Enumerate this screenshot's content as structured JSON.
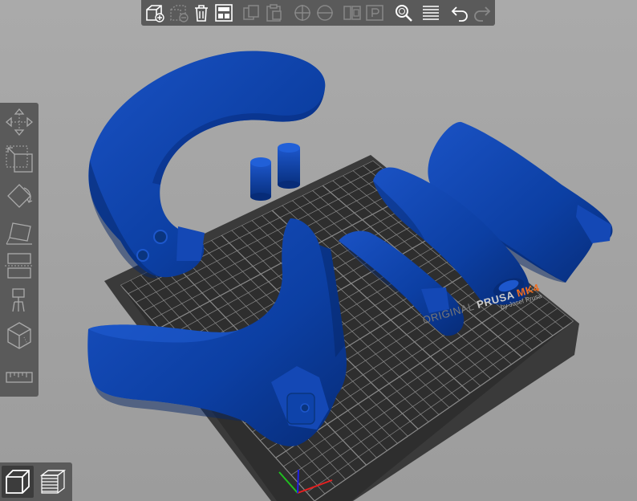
{
  "app": "PrusaSlicer 3D view",
  "toolbar": {
    "buttons": [
      {
        "name": "add-button",
        "icon": "cube-add-icon",
        "enabled": true
      },
      {
        "name": "delete-button",
        "icon": "cube-delete-icon",
        "enabled": false
      },
      {
        "name": "delete-all-button",
        "icon": "trash-icon",
        "enabled": true
      },
      {
        "name": "arrange-button",
        "icon": "arrange-icon",
        "enabled": true
      },
      {
        "name": "copy-button",
        "icon": "copy-icon",
        "enabled": false
      },
      {
        "name": "paste-button",
        "icon": "paste-icon",
        "enabled": false
      },
      {
        "name": "add-instance-button",
        "icon": "plus-icon",
        "enabled": false
      },
      {
        "name": "remove-instance-button",
        "icon": "minus-icon",
        "enabled": false
      },
      {
        "name": "split-objects-button",
        "icon": "split-objects-icon",
        "enabled": false
      },
      {
        "name": "split-parts-button",
        "icon": "split-parts-icon",
        "enabled": false
      },
      {
        "name": "search-button",
        "icon": "search-icon",
        "enabled": true
      },
      {
        "name": "layer-editing-button",
        "icon": "layers-icon",
        "enabled": true
      },
      {
        "name": "undo-button",
        "icon": "undo-icon",
        "enabled": true
      },
      {
        "name": "redo-button",
        "icon": "redo-icon",
        "enabled": false
      }
    ]
  },
  "side_toolbar": {
    "tools": [
      {
        "name": "move-tool",
        "icon": "move-icon"
      },
      {
        "name": "scale-tool",
        "icon": "scale-icon"
      },
      {
        "name": "rotate-tool",
        "icon": "rotate-icon"
      },
      {
        "name": "place-on-face-tool",
        "icon": "place-on-face-icon"
      },
      {
        "name": "cut-tool",
        "icon": "cut-icon"
      },
      {
        "name": "paint-supports-tool",
        "icon": "paint-supports-icon"
      },
      {
        "name": "seam-painting-tool",
        "icon": "seam-icon"
      },
      {
        "name": "measure-tool",
        "icon": "measure-icon"
      }
    ]
  },
  "view_toggle": {
    "items": [
      {
        "name": "3d-view-button",
        "icon": "3d-view-icon",
        "active": true
      },
      {
        "name": "preview-button",
        "icon": "preview-layers-icon",
        "active": false
      }
    ]
  },
  "bed": {
    "brand_original": "ORIGINAL",
    "brand_prusa": "PRUSA",
    "brand_model": "MK4",
    "brand_by": "by Josef Prusa",
    "colors": {
      "sheet": "#2e2e2e",
      "grid": "#8a8a8a",
      "frame": "#3a3a3a"
    }
  },
  "model_color": "#0c3fa3",
  "axis_colors": {
    "x": "#e62020",
    "y": "#20c020",
    "z": "#2020e6"
  }
}
